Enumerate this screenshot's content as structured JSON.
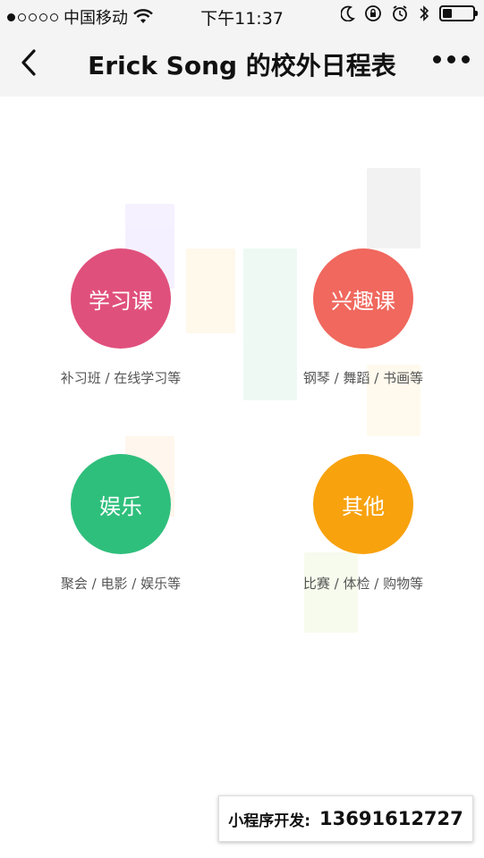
{
  "status_bar": {
    "carrier": "中国移动",
    "time": "下午11:37",
    "signal_bars_filled": 1,
    "signal_bars_total": 5,
    "battery_level": 0.3
  },
  "nav": {
    "title": "Erick Song 的校外日程表"
  },
  "categories": [
    {
      "label": "学习课",
      "desc": "补习班 / 在线学习等",
      "color": "#e0507c"
    },
    {
      "label": "兴趣课",
      "desc": "钢琴 / 舞蹈 / 书画等",
      "color": "#f0685e"
    },
    {
      "label": "娱乐",
      "desc": "聚会 / 电影 / 娱乐等",
      "color": "#2fbf7c"
    },
    {
      "label": "其他",
      "desc": "比赛 / 体检 / 购物等",
      "color": "#f8a20e"
    }
  ],
  "contact": {
    "label": "小程序开发:",
    "number": "13691612727"
  },
  "colors": {
    "bar_background": "#f4f4f4",
    "text_dark": "#111111"
  }
}
